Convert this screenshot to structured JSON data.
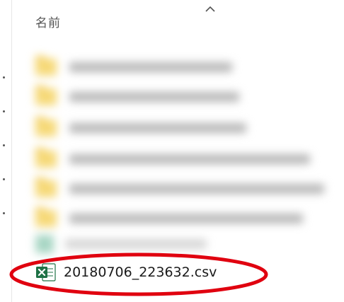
{
  "header": {
    "name_column_label": "名前"
  },
  "file": {
    "name": "20180706_223632.csv",
    "icon": "excel-csv-icon"
  },
  "colors": {
    "annotation_ellipse": "#e0000f",
    "folder_icon": "#f6d978",
    "excel_green": "#1e7145"
  }
}
